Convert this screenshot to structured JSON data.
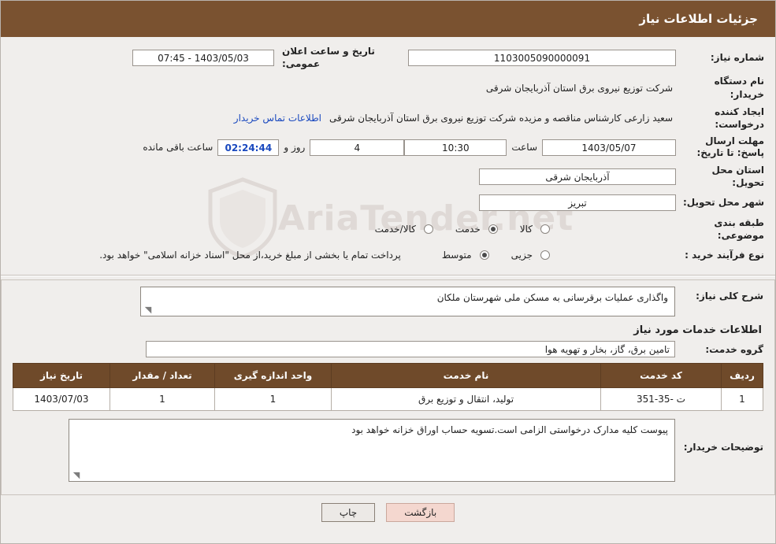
{
  "header": {
    "title": "جزئیات اطلاعات نیاز"
  },
  "form": {
    "need_number_label": "شماره نیاز:",
    "need_number_value": "1103005090000091",
    "public_announce_label": "تاریخ و ساعت اعلان عمومی:",
    "public_announce_value": "1403/05/03 - 07:45",
    "buyer_org_label": "نام دستگاه خریدار:",
    "buyer_org_value": "شرکت توزیع نیروی برق استان آذربایجان شرقی",
    "creator_label": "ایجاد کننده درخواست:",
    "creator_value": "سعید زارعی کارشناس مناقصه و مزیده شرکت توزیع نیروی برق استان آذربایجان شرقی",
    "contact_link": "اطلاعات تماس خریدار",
    "deadline_label": "مهلت ارسال پاسخ: تا تاریخ:",
    "deadline_date": "1403/05/07",
    "deadline_hour_label": "ساعت",
    "deadline_hour": "10:30",
    "remaining_days": "4",
    "remaining_days_label": "روز و",
    "remaining_time": "02:24:44",
    "remaining_time_label": "ساعت باقی مانده",
    "province_label": "استان محل تحویل:",
    "province_value": "آذربایجان شرقی",
    "city_label": "شهر محل تحویل:",
    "city_value": "تبریز",
    "category_label": "طبقه بندی موضوعی:",
    "category_options": [
      "کالا",
      "خدمت",
      "کالا/خدمت"
    ],
    "category_selected": "خدمت",
    "purchase_type_label": "نوع فرآیند خرید :",
    "purchase_options": [
      "جزیی",
      "متوسط"
    ],
    "purchase_selected": "متوسط",
    "purchase_note": "پرداخت تمام یا بخشی از مبلغ خرید،از محل \"اسناد خزانه اسلامی\" خواهد بود."
  },
  "details": {
    "general_desc_label": "شرح کلی نیاز:",
    "general_desc_value": "واگذاری عملیات برقرسانی به مسکن ملی شهرستان ملکان",
    "services_info_title": "اطلاعات خدمات مورد نیاز",
    "service_group_label": "گروه خدمت:",
    "service_group_value": "تامین برق، گاز، بخار و تهویه هوا",
    "table": {
      "columns": [
        "ردیف",
        "کد خدمت",
        "نام خدمت",
        "واحد اندازه گیری",
        "تعداد / مقدار",
        "تاریخ نیاز"
      ],
      "rows": [
        {
          "radif": "1",
          "code": "ت -35-351",
          "name": "تولید، انتقال و توزیع برق",
          "unit": "1",
          "qty": "1",
          "date": "1403/07/03"
        }
      ]
    },
    "buyer_notes_label": "توضیحات خریدار:",
    "buyer_notes_value": "پیوست کلیه مدارک درخواستی الزامی است.تسویه حساب اوراق خزانه خواهد بود"
  },
  "buttons": {
    "print": "چاپ",
    "back": "بازگشت"
  },
  "watermark": {
    "text": "AriaTender.net"
  }
}
